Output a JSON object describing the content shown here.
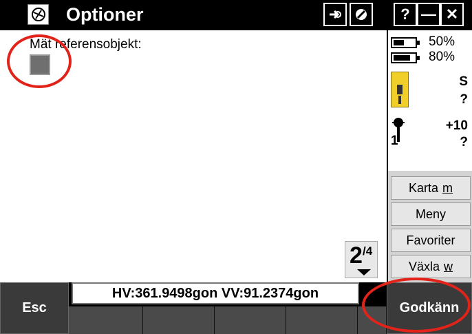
{
  "window": {
    "title": "Optioner",
    "buttons": {
      "help": "?",
      "minimize": "—",
      "close": "✕"
    }
  },
  "form": {
    "field_label": "Mät referensobjekt:",
    "checkbox_checked": false
  },
  "page_indicator": {
    "current": "2",
    "total": "/4"
  },
  "status": {
    "battery_1": "50%",
    "battery_1_level": 0.5,
    "battery_2": "80%",
    "battery_2_level": 0.8,
    "instrument_mode": "S",
    "instrument_value": "?",
    "target_offset": "+10",
    "target_number": "1",
    "target_value": "?"
  },
  "side_buttons": [
    {
      "label": "Karta",
      "key": "m"
    },
    {
      "label": "Meny"
    },
    {
      "label": "Favoriter"
    },
    {
      "label": "Växla",
      "key": "w"
    }
  ],
  "bottom": {
    "esc_label": "Esc",
    "readout": "HV:361.9498gon  VV:91.2374gon",
    "accept_label": "Godkänn"
  },
  "icons": [
    "app-logo-icon",
    "forward-icon",
    "no-entry-icon",
    "battery-icon",
    "total-station-icon",
    "prism-target-icon",
    "chevron-down-icon"
  ],
  "colors": {
    "title_bg": "#000000",
    "highlight_ring": "#e2231a",
    "instrument": "#f1cf2a"
  }
}
